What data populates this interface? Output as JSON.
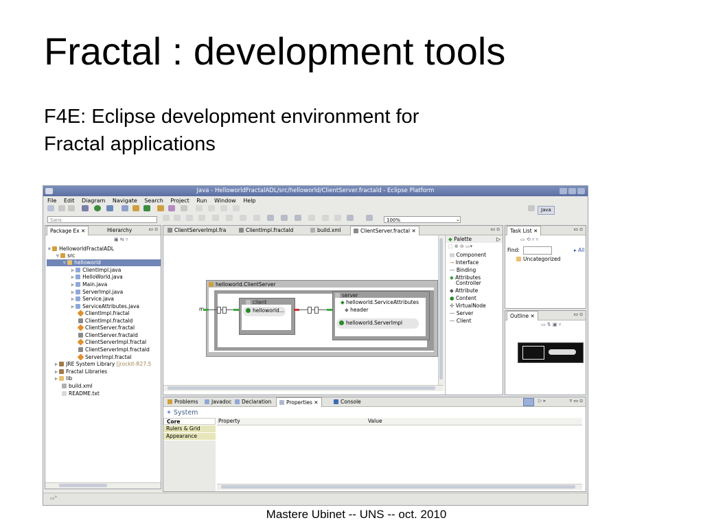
{
  "slide": {
    "title": "Fractal : development tools",
    "subtitle_line1": "F4E:  Eclipse development environment for",
    "subtitle_line2": "Fractal applications",
    "footer": "Mastere Ubinet  --  UNS -- oct. 2010"
  },
  "eclipse": {
    "window_title": "Java - HelloworldFractalADL/src/helloworld/ClientServer.fractald - Eclipse Platform",
    "menu": [
      "File",
      "Edit",
      "Diagram",
      "Navigate",
      "Search",
      "Project",
      "Run",
      "Window",
      "Help"
    ],
    "font_combo": "Sans",
    "zoom": "100%",
    "perspective": "Java",
    "left_tabs": [
      "Package Ex",
      "Hierarchy"
    ],
    "tree": [
      "HelloworldFractalADL",
      "src",
      "helloworld",
      "ClientImpl.java",
      "HelloWorld.java",
      "Main.java",
      "ServerImpl.java",
      "Service.java",
      "ServiceAttributes.java",
      "ClientImpl.fractal",
      "ClientImpl.fractald",
      "ClientServer.fractal",
      "ClientServer.fractald",
      "ClientServerImpl.fractal",
      "ClientServerImpl.fractald",
      "ServerImpl.fractal",
      "JRE System Library",
      "Fractal Libraries",
      "lib",
      "build.xml",
      "README.txt"
    ],
    "jre_suffix": "[jrockit-R27.5",
    "editor_tabs": [
      "ClientServerImpl.fra",
      "ClientImpl.fractald",
      "build.xml",
      "ClientServer.fractal"
    ],
    "diagram": {
      "composite": "helloworld.ClientServer",
      "client": "client",
      "client_impl": "helloworld...",
      "server": "server",
      "server_attr": "helloworld.ServiceAttributes",
      "server_header": "header",
      "server_impl": "helloworld.ServerImpl",
      "port_m": "m"
    },
    "palette_title": "Palette",
    "palette": [
      "Component",
      "Interface",
      "Binding",
      "Attributes",
      "Controller",
      "Attribute",
      "Content",
      "VirtualNode",
      "Server",
      "Client"
    ],
    "tasklist": {
      "tab": "Task List",
      "find_label": "Find:",
      "all": "All",
      "category": "Uncategorized"
    },
    "outline_tab": "Outline",
    "bottom_tabs": [
      "Problems",
      "Javadoc",
      "Declaration",
      "Properties",
      "Console"
    ],
    "properties": {
      "section": "System",
      "tabs": [
        "Core",
        "Rulers & Grid",
        "Appearance"
      ],
      "col_property": "Property",
      "col_value": "Value"
    },
    "colors": {
      "titlebar": "#6a7eb2",
      "selection": "#6f86b7",
      "palette_green": "#3a9a3a"
    }
  }
}
